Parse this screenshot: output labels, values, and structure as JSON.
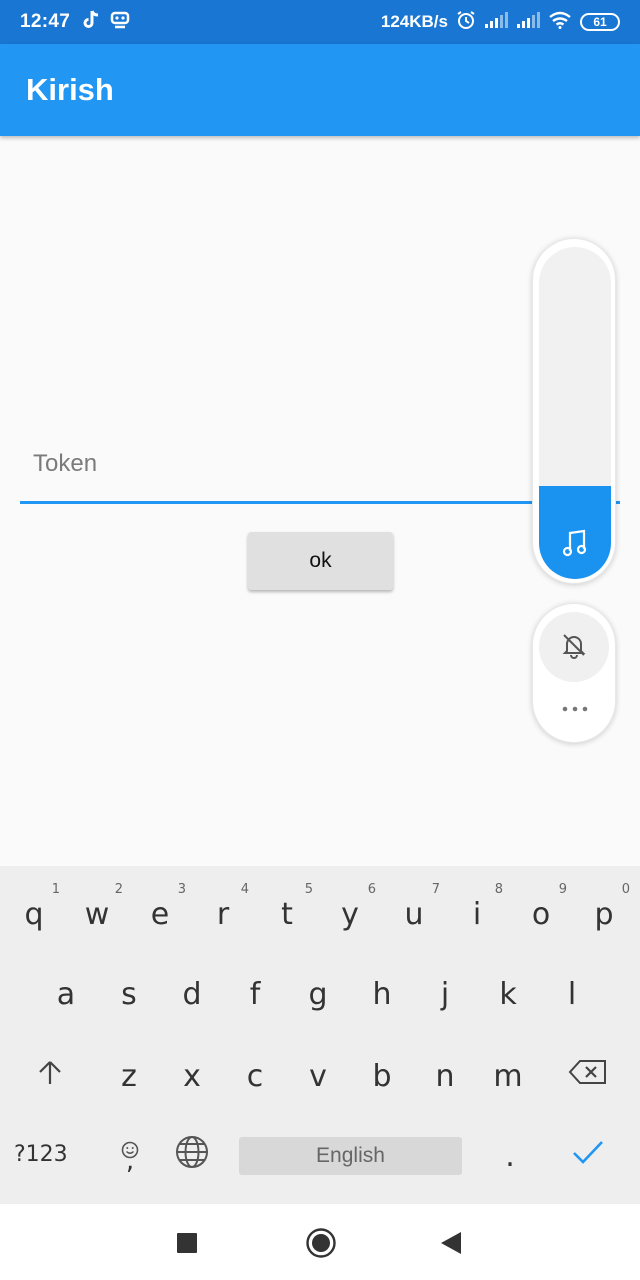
{
  "status_bar": {
    "time": "12:47",
    "net_speed": "124KB/s",
    "battery": "61",
    "left_icons": [
      "tiktok-icon",
      "app-notification-icon"
    ],
    "right_icons": [
      "alarm-icon",
      "signal-icon",
      "signal-icon",
      "wifi-icon"
    ]
  },
  "app_bar": {
    "title": "Kirish"
  },
  "form": {
    "token_placeholder": "Token",
    "ok_label": "ok"
  },
  "volume_panel": {
    "level": 0.28,
    "fill_color": "#1a93f0",
    "icons": [
      "music-note-icon",
      "bell-off-icon",
      "more-icon"
    ]
  },
  "keyboard": {
    "row1": [
      {
        "key": "q",
        "hint": "1"
      },
      {
        "key": "w",
        "hint": "2"
      },
      {
        "key": "e",
        "hint": "3"
      },
      {
        "key": "r",
        "hint": "4"
      },
      {
        "key": "t",
        "hint": "5"
      },
      {
        "key": "y",
        "hint": "6"
      },
      {
        "key": "u",
        "hint": "7"
      },
      {
        "key": "i",
        "hint": "8"
      },
      {
        "key": "o",
        "hint": "9"
      },
      {
        "key": "p",
        "hint": "0"
      }
    ],
    "row2": [
      "a",
      "s",
      "d",
      "f",
      "g",
      "h",
      "j",
      "k",
      "l"
    ],
    "row3": [
      "z",
      "x",
      "c",
      "v",
      "b",
      "n",
      "m"
    ],
    "symbols_label": "?123",
    "emoji_comma": ",",
    "space_label": "English",
    "period": ".",
    "accent_color": "#2196f3"
  },
  "nav_bar": {
    "icons": [
      "recents-icon",
      "home-icon",
      "back-icon"
    ]
  }
}
